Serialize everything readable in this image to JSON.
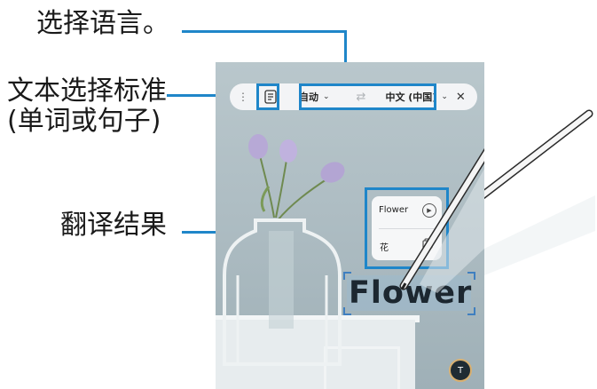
{
  "callouts": {
    "language": "选择语言。",
    "mode_line1": "文本选择标准",
    "mode_line2": "(单词或句子)",
    "result": "翻译结果"
  },
  "toolbar": {
    "source_language": "自动",
    "target_language": "中文 (中国)",
    "swap_icon": "swap-arrows-icon",
    "close_icon": "close-icon",
    "mode_icon": "text-lines-icon"
  },
  "result_card": {
    "word": "Flower",
    "translation": "花",
    "play_icon": "play-icon",
    "copy_icon": "copy-icon"
  },
  "selection": {
    "text": "Flower"
  },
  "colors": {
    "accent": "#1f86c9",
    "background_wall": "#aebdc3"
  }
}
